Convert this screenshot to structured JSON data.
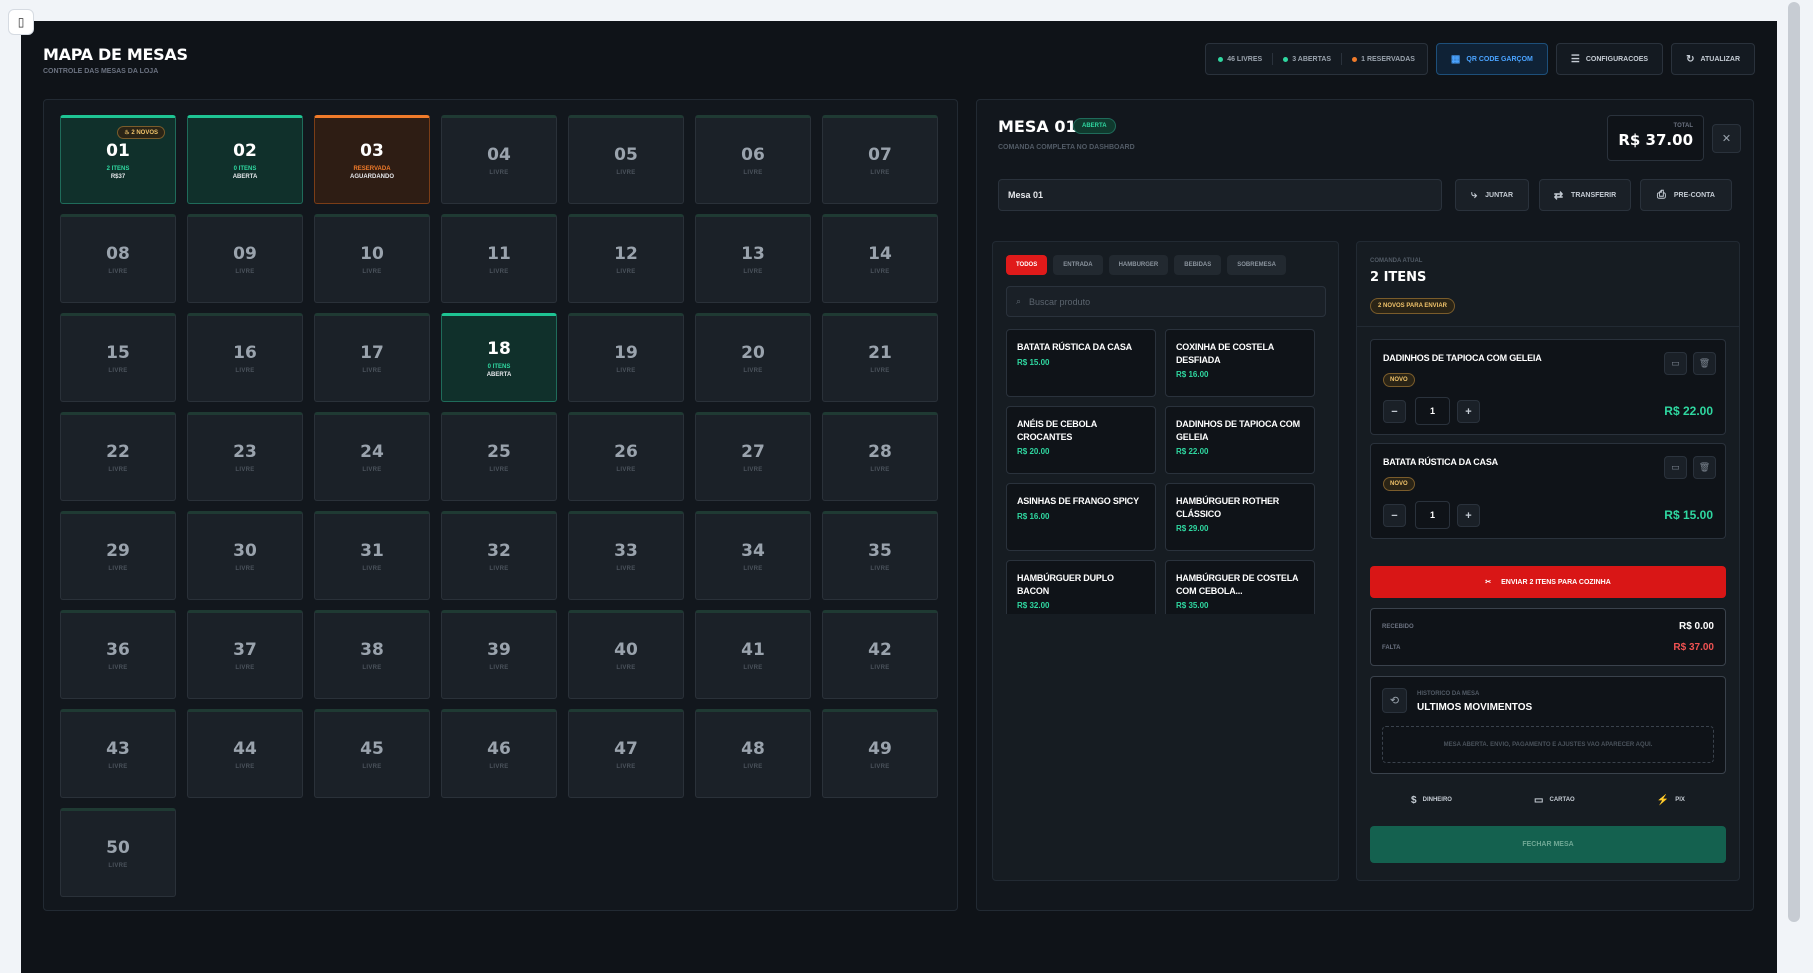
{
  "header": {
    "title": "MAPA DE MESAS",
    "subtitle": "CONTROLE DAS MESAS DA LOJA",
    "status": [
      {
        "label": "46 LIVRES",
        "color": "#2fd7a0"
      },
      {
        "label": "3 ABERTAS",
        "color": "#2fd7a0"
      },
      {
        "label": "1 RESERVADAS",
        "color": "#f07b2a"
      }
    ],
    "qr_label": "QR CODE GARÇOM",
    "settings_label": "CONFIGURACOES",
    "refresh_label": "ATUALIZAR"
  },
  "tables": [
    {
      "num": "01",
      "state": "open",
      "line1": "2 ITENS",
      "line2": "R$37",
      "badge": "2 NOVOS"
    },
    {
      "num": "02",
      "state": "open",
      "line1": "0 ITENS",
      "line2": "ABERTA"
    },
    {
      "num": "03",
      "state": "reserved",
      "line1": "RESERVADA",
      "line2": "AGUARDANDO"
    },
    {
      "num": "04",
      "state": "free",
      "line1": "LIVRE"
    },
    {
      "num": "05",
      "state": "free",
      "line1": "LIVRE"
    },
    {
      "num": "06",
      "state": "free",
      "line1": "LIVRE"
    },
    {
      "num": "07",
      "state": "free",
      "line1": "LIVRE"
    },
    {
      "num": "08",
      "state": "free",
      "line1": "LIVRE"
    },
    {
      "num": "09",
      "state": "free",
      "line1": "LIVRE"
    },
    {
      "num": "10",
      "state": "free",
      "line1": "LIVRE"
    },
    {
      "num": "11",
      "state": "free",
      "line1": "LIVRE"
    },
    {
      "num": "12",
      "state": "free",
      "line1": "LIVRE"
    },
    {
      "num": "13",
      "state": "free",
      "line1": "LIVRE"
    },
    {
      "num": "14",
      "state": "free",
      "line1": "LIVRE"
    },
    {
      "num": "15",
      "state": "free",
      "line1": "LIVRE"
    },
    {
      "num": "16",
      "state": "free",
      "line1": "LIVRE"
    },
    {
      "num": "17",
      "state": "free",
      "line1": "LIVRE"
    },
    {
      "num": "18",
      "state": "open",
      "line1": "0 ITENS",
      "line2": "ABERTA"
    },
    {
      "num": "19",
      "state": "free",
      "line1": "LIVRE"
    },
    {
      "num": "20",
      "state": "free",
      "line1": "LIVRE"
    },
    {
      "num": "21",
      "state": "free",
      "line1": "LIVRE"
    },
    {
      "num": "22",
      "state": "free",
      "line1": "LIVRE"
    },
    {
      "num": "23",
      "state": "free",
      "line1": "LIVRE"
    },
    {
      "num": "24",
      "state": "free",
      "line1": "LIVRE"
    },
    {
      "num": "25",
      "state": "free",
      "line1": "LIVRE"
    },
    {
      "num": "26",
      "state": "free",
      "line1": "LIVRE"
    },
    {
      "num": "27",
      "state": "free",
      "line1": "LIVRE"
    },
    {
      "num": "28",
      "state": "free",
      "line1": "LIVRE"
    },
    {
      "num": "29",
      "state": "free",
      "line1": "LIVRE"
    },
    {
      "num": "30",
      "state": "free",
      "line1": "LIVRE"
    },
    {
      "num": "31",
      "state": "free",
      "line1": "LIVRE"
    },
    {
      "num": "32",
      "state": "free",
      "line1": "LIVRE"
    },
    {
      "num": "33",
      "state": "free",
      "line1": "LIVRE"
    },
    {
      "num": "34",
      "state": "free",
      "line1": "LIVRE"
    },
    {
      "num": "35",
      "state": "free",
      "line1": "LIVRE"
    },
    {
      "num": "36",
      "state": "free",
      "line1": "LIVRE"
    },
    {
      "num": "37",
      "state": "free",
      "line1": "LIVRE"
    },
    {
      "num": "38",
      "state": "free",
      "line1": "LIVRE"
    },
    {
      "num": "39",
      "state": "free",
      "line1": "LIVRE"
    },
    {
      "num": "40",
      "state": "free",
      "line1": "LIVRE"
    },
    {
      "num": "41",
      "state": "free",
      "line1": "LIVRE"
    },
    {
      "num": "42",
      "state": "free",
      "line1": "LIVRE"
    },
    {
      "num": "43",
      "state": "free",
      "line1": "LIVRE"
    },
    {
      "num": "44",
      "state": "free",
      "line1": "LIVRE"
    },
    {
      "num": "45",
      "state": "free",
      "line1": "LIVRE"
    },
    {
      "num": "46",
      "state": "free",
      "line1": "LIVRE"
    },
    {
      "num": "47",
      "state": "free",
      "line1": "LIVRE"
    },
    {
      "num": "48",
      "state": "free",
      "line1": "LIVRE"
    },
    {
      "num": "49",
      "state": "free",
      "line1": "LIVRE"
    },
    {
      "num": "50",
      "state": "free",
      "line1": "LIVRE"
    }
  ],
  "detail": {
    "title": "MESA 01",
    "status": "ABERTA",
    "subtitle": "COMANDA COMPLETA NO DASHBOARD",
    "total_label": "TOTAL",
    "total_value": "R$ 37.00",
    "name_value": "Mesa 01",
    "join_label": "JUNTAR",
    "transfer_label": "TRANSFERIR",
    "precheck_label": "PRE-CONTA"
  },
  "products": {
    "categories": [
      "TODOS",
      "ENTRADA",
      "HAMBURGER",
      "BEBIDAS",
      "SOBREMESA"
    ],
    "active_category": "TODOS",
    "search_placeholder": "Buscar produto",
    "items": [
      {
        "name": "BATATA RÚSTICA DA CASA",
        "price": "R$ 15.00"
      },
      {
        "name": "COXINHA DE COSTELA DESFIADA",
        "price": "R$ 16.00"
      },
      {
        "name": "ANÉIS DE CEBOLA CROCANTES",
        "price": "R$ 20.00"
      },
      {
        "name": "DADINHOS DE TAPIOCA COM GELEIA",
        "price": "R$ 22.00"
      },
      {
        "name": "ASINHAS DE FRANGO SPICY",
        "price": "R$ 16.00"
      },
      {
        "name": "HAMBÚRGUER ROTHER CLÁSSICO",
        "price": "R$ 29.00"
      },
      {
        "name": "HAMBÚRGUER DUPLO BACON",
        "price": "R$ 32.00"
      },
      {
        "name": "HAMBÚRGUER DE COSTELA COM CEBOLA...",
        "price": "R$ 35.00"
      }
    ]
  },
  "order": {
    "label": "COMANDA ATUAL",
    "count": "2 ITENS",
    "to_send": "2 NOVOS PARA ENVIAR",
    "items": [
      {
        "name": "DADINHOS DE TAPIOCA COM GELEIA",
        "badge": "NOVO",
        "qty": "1",
        "price": "R$ 22.00"
      },
      {
        "name": "BATATA RÚSTICA DA CASA",
        "badge": "NOVO",
        "qty": "1",
        "price": "R$ 15.00"
      }
    ],
    "send_label": "ENVIAR 2 ITENS PARA COZINHA",
    "received_label": "RECEBIDO",
    "received_value": "R$ 0.00",
    "missing_label": "FALTA",
    "missing_value": "R$ 37.00",
    "history_kicker": "HISTORICO DA MESA",
    "history_title": "ULTIMOS MOVIMENTOS",
    "history_empty": "MESA ABERTA. ENVIO, PAGAMENTO E AJUSTES VAO APARECER AQUI.",
    "methods": [
      "DINHEIRO",
      "CARTAO",
      "PIX"
    ],
    "close_label": "FECHAR MESA"
  }
}
